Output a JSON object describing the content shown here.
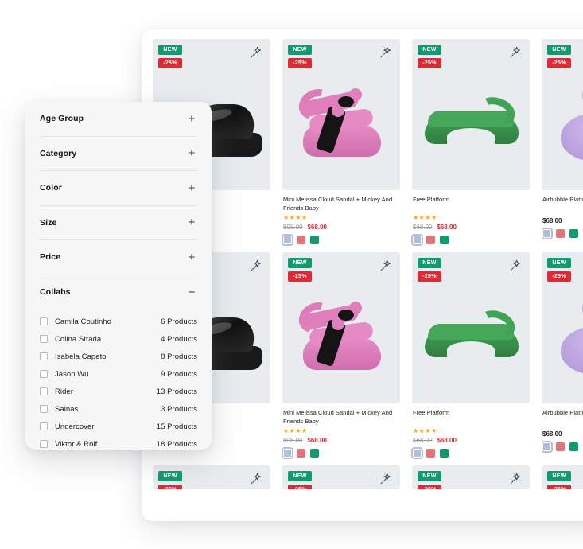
{
  "filters": {
    "sections": [
      {
        "label": "Age Group",
        "state": "collapsed",
        "toggle": "+"
      },
      {
        "label": "Category",
        "state": "collapsed",
        "toggle": "+"
      },
      {
        "label": "Color",
        "state": "collapsed",
        "toggle": "+"
      },
      {
        "label": "Size",
        "state": "collapsed",
        "toggle": "+"
      },
      {
        "label": "Price",
        "state": "collapsed",
        "toggle": "+"
      },
      {
        "label": "Collabs",
        "state": "expanded",
        "toggle": "−"
      }
    ],
    "collabs": [
      {
        "name": "Camila Coutinho",
        "count": "6 Products",
        "checked": false
      },
      {
        "name": "Colina Strada",
        "count": "4 Products",
        "checked": false
      },
      {
        "name": "Isabela Capeto",
        "count": "8 Products",
        "checked": false
      },
      {
        "name": "Jason Wu",
        "count": "9 Products",
        "checked": false
      },
      {
        "name": "Rider",
        "count": "13 Products",
        "checked": false
      },
      {
        "name": "Sainas",
        "count": "3 Products",
        "checked": false
      },
      {
        "name": "Undercover",
        "count": "15 Products",
        "checked": false
      },
      {
        "name": "Viktor & Rolf",
        "count": "18 Products",
        "checked": false
      }
    ]
  },
  "badges": {
    "new_label": "NEW",
    "discount_label": "-25%",
    "new_color": "#0f9b6c",
    "discount_color": "#df2935"
  },
  "rating": {
    "filled": "★★★★",
    "empty": "☆",
    "filled_color": "#f5a623",
    "empty_color": "#d8d8d8"
  },
  "swatch_colors": {
    "blue": "#aebedd",
    "coral": "#e0767b",
    "green": "#0f9b6c"
  },
  "products": {
    "row1": [
      {
        "name": "",
        "price_old": "",
        "price_new": "",
        "shoe": "black-platform-loafer",
        "swatches": []
      },
      {
        "name": "Mini Melissa Cloud Sandal + Mickey And Friends Baby",
        "price_old": "$98.00",
        "price_new": "$68.00",
        "shoe": "pink-mickey-sandal",
        "swatches": [
          "blue",
          "coral",
          "green"
        ]
      },
      {
        "name": "Free Platform",
        "price_old": "$68.00",
        "price_new": "$68.00",
        "shoe": "green-flip-flop",
        "swatches": [
          "blue",
          "coral",
          "green"
        ]
      },
      {
        "name": "Airbubble Platform",
        "price_old": "",
        "price_new": "$68.00",
        "shoe": "lilac-airbubble",
        "swatches": [
          "blue",
          "coral",
          "green"
        ]
      }
    ],
    "row2": [
      {
        "name": "",
        "price_old": "",
        "price_new": "",
        "shoe": "black-platform-loafer",
        "swatches": []
      },
      {
        "name": "Mini Melissa Cloud Sandal + Mickey And Friends Baby",
        "price_old": "$98.00",
        "price_new": "$68.00",
        "shoe": "pink-mickey-sandal",
        "swatches": [
          "blue",
          "coral",
          "green"
        ]
      },
      {
        "name": "Free Platform",
        "price_old": "$68.00",
        "price_new": "$68.00",
        "shoe": "green-flip-flop",
        "swatches": [
          "blue",
          "coral",
          "green"
        ]
      },
      {
        "name": "Airbubble Platform",
        "price_old": "",
        "price_new": "$68.00",
        "shoe": "lilac-airbubble",
        "swatches": [
          "blue",
          "coral",
          "green"
        ]
      }
    ]
  }
}
